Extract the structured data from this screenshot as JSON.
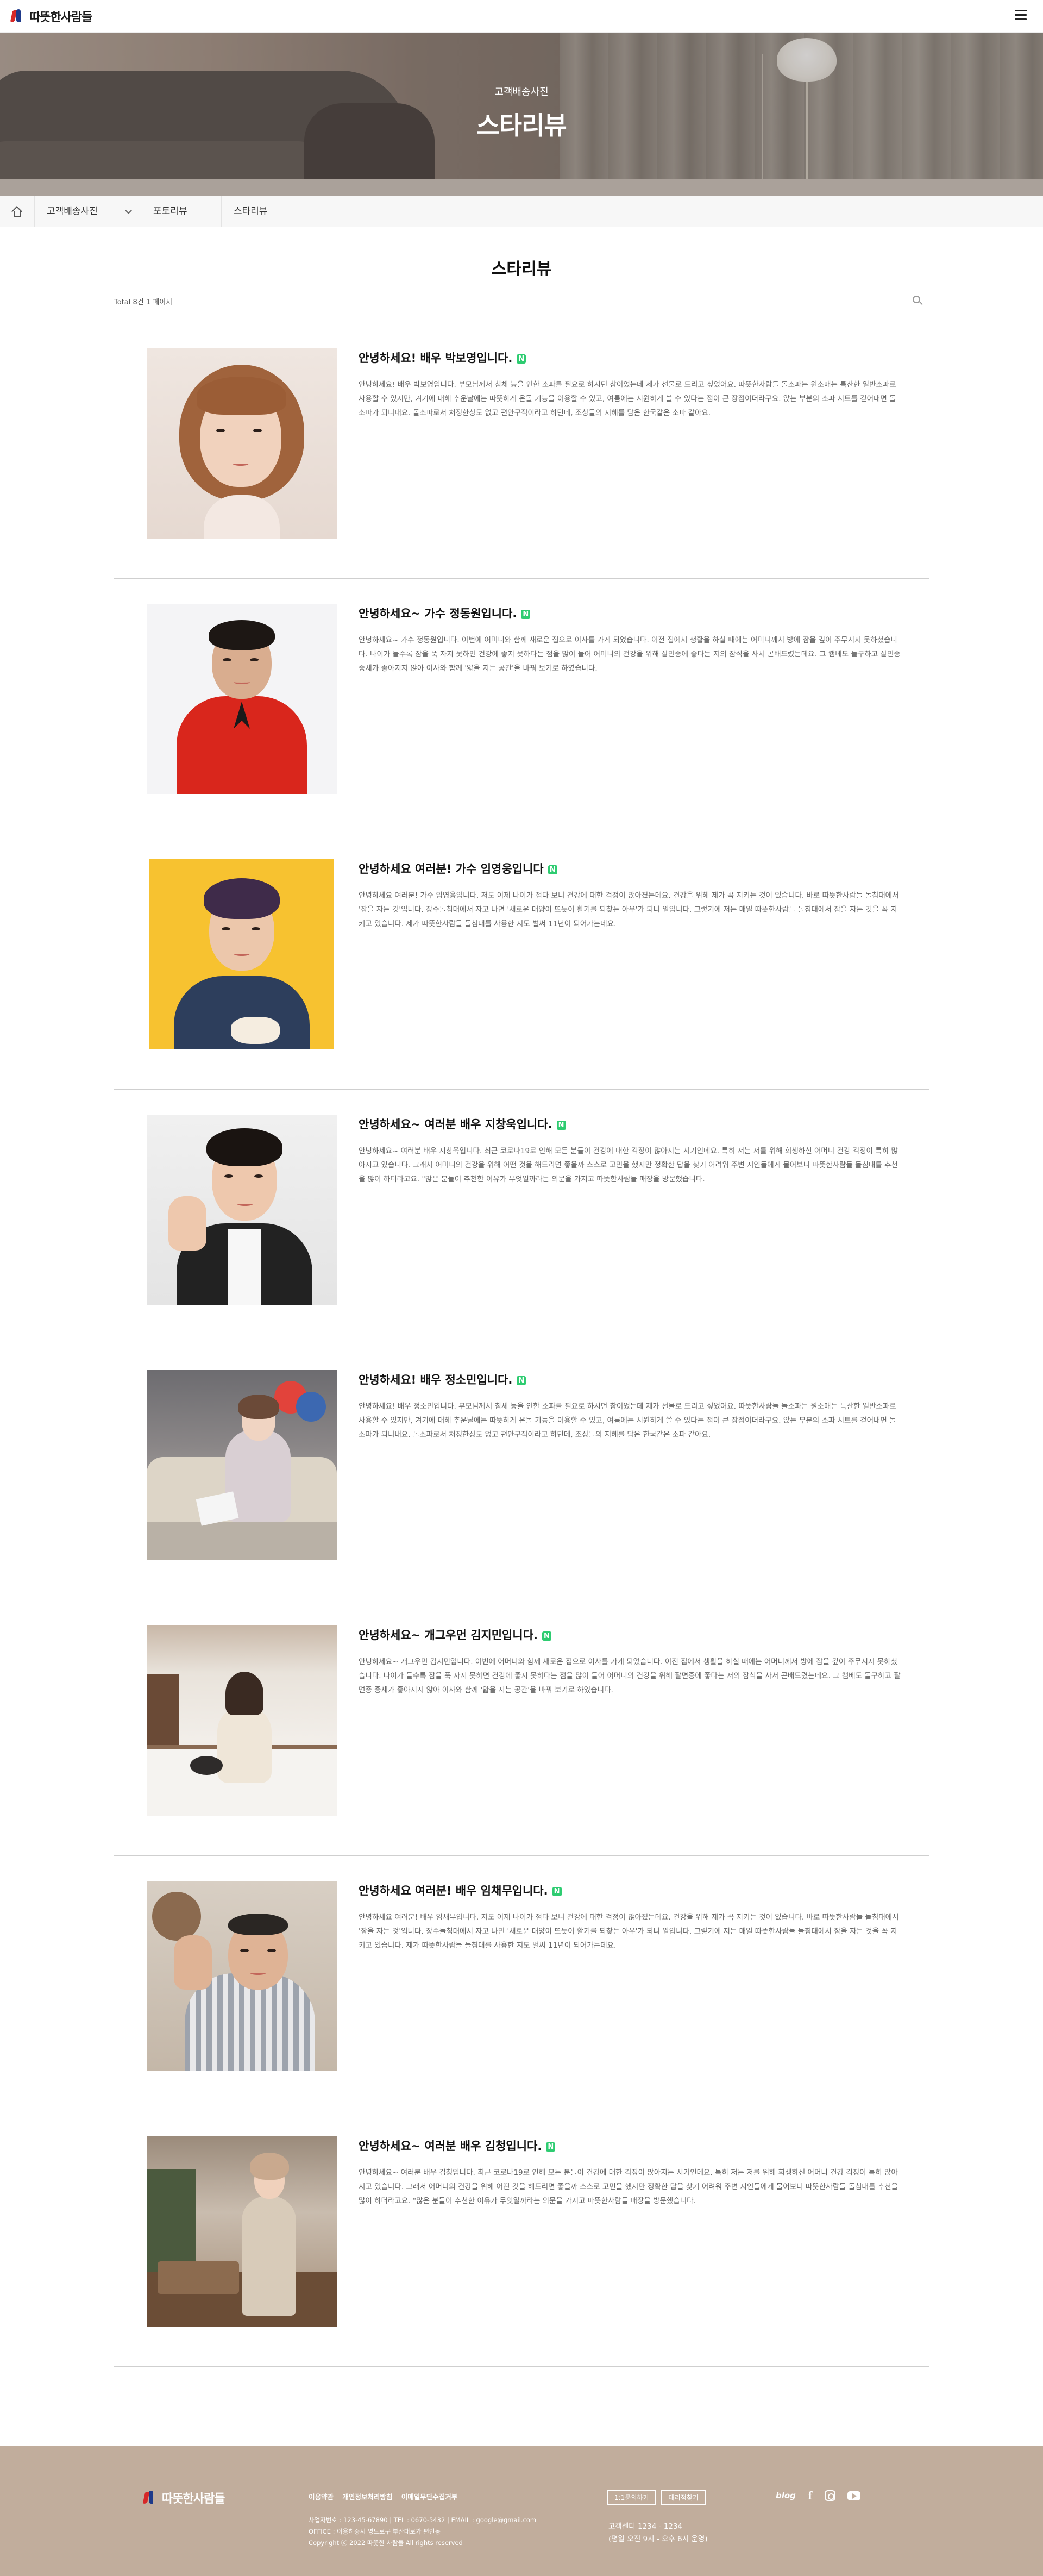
{
  "header": {
    "logo_text": "따뜻한사람들",
    "menu_icon": "hamburger-menu-icon"
  },
  "hero": {
    "subtitle": "고객배송사진",
    "title": "스타리뷰"
  },
  "subnav": {
    "home_icon": "home-icon",
    "items": [
      "고객배송사진",
      "포토리뷰",
      "스타리뷰"
    ]
  },
  "board": {
    "title": "스타리뷰",
    "total_text": "Total 8건 1 페이지",
    "search_icon": "search-icon",
    "new_badge": "N"
  },
  "posts": [
    {
      "title": "안녕하세요! 배우 박보영입니다.",
      "excerpt": "안녕하세요! 배우 박보영입니다. 부모님께서 침체 능을 인한 소파를 필요로 하시던 참이었는데 제가 선물로 드리고 싶었어요. 따뜻한사람들 돌소파는 원소매는 특산한 일반소파로 사용할 수 있지만, 겨기에 대해 추운날에는 따뜻하게 온돌 기능을 이용할 수 있고, 여름에는 시원하게 쓸 수 있다는 점이 큰 장점이더라구요. 앉는 부분의 소파 시트를 걷어내면 돌소파가 되니내요. 돌소파로서 처정한상도 없고 편안구적이라고 하던데, 조상들의 지혜를 담은 한국같은 소파 같아요."
    },
    {
      "title": "안녕하세요~ 가수 정동원입니다.",
      "excerpt": "안녕하세요~ 가수 정동원입니다. 이번에 어머니와 함께 새로운 집으로 이사를 가게 되었습니다. 이전 집에서 생활을 하실 때에는 어머니께서 방에 잠을 깊이 주무시지 못하셨습니다. 나이가 들수록 잠을 푹 자지 못하면 건강에 좋지 못하다는 점을 많이 들어 어머니의 건강을 위해 잘면증에 좋다는 저의 잠식을 사서 곤배드렸는데요. 그 캠베도 돌구하고 잘면증 증세가 좋아지지 않아 이사와 함께 '얇을 지는 공간'을 바꿔 보기로 하였습니다."
    },
    {
      "title": "안녕하세요 여러분! 가수 임영웅입니다",
      "excerpt": "안녕하세요 여러분! 가수 임영웅입니다. 저도 이제 나이가 점다 보니 건강에 대한 걱정이 많아졌는데요. 건강을 위해 제가 꼭 지키는 것이 있습니다. 바로 따뜻한사람들 돌침대에서 '잠을 자는 것'입니다. 장수돌침대에서 자고 나면 '새로운 대양이 뜨듯이 활기를 되찾는 아우'가 되니 일입니다. 그렇기에 저는 매일 따뜻한사람들 돌침대에서 잠을 자는 것을 꼭 지키고 있습니다. 제가 따뜻한사람들 돌침대를 사용한 지도 벌써 11년이 되어가는데요."
    },
    {
      "title": "안녕하세요~ 여러분 배우 지창욱입니다.",
      "excerpt": "안녕하세요~ 여러분 배우 지창욱입니다. 최근 코로나19로 인해 모든 분들이 건강에 대한 걱정이 많아지는 시기인데요. 특히 저는 저를 위해 희생하신 어머니 건강 걱정이 특히 많아지고 있습니다. 그래서 어머니의 건강을 위해 어떤 것을 해드리면 좋을까 스스로 고민을 했지만 정확한 답을 찾기 어려워 주변 지인들에게 물어보니 따뜻한사람들 돌침대를 추천을 많이 하더라고요. \"많은 분들이 추천한 이유가 무엇일까라는 의문을 가지고 따뜻한사람들 매장을 방문했습니다."
    },
    {
      "title": "안녕하세요! 배우 정소민입니다.",
      "excerpt": "안녕하세요! 배우 정소민입니다. 부모님께서 침체 능을 인한 소파를 필요로 하시던 참이었는데 제가 선물로 드리고 싶었어요. 따뜻한사람들 돌소파는 원소매는 특산한 일반소파로 사용할 수 있지만, 겨기에 대해 추운날에는 따뜻하게 온돌 기능을 이용할 수 있고, 여름에는 시원하게 쓸 수 있다는 점이 큰 장점이더라구요. 앉는 부분의 소파 시트를 걷어내면 돌소파가 되니내요. 돌소파로서 처정한상도 없고 편안구적이라고 하던데, 조상들의 지혜를 담은 한국같은 소파 같아요."
    },
    {
      "title": "안녕하세요~ 개그우먼 김지민입니다.",
      "excerpt": "안녕하세요~ 개그우먼 김지민입니다. 이번에 어머니와 함께 새로운 집으로 이사를 가게 되었습니다. 이전 집에서 생활을 하실 때에는 어머니께서 방에 잠을 깊이 주무시지 못하셨습니다. 나이가 들수록 잠을 푹 자지 못하면 건강에 좋지 못하다는 점을 많이 들어 어머니의 건강을 위해 잘면증에 좋다는 저의 잠식을 사서 곤배드렸는데요. 그 캠베도 돌구하고 잘면증 증세가 좋아지지 않아 이사와 함께 '얇을 지는 공간'을 바꿔 보기로 하였습니다."
    },
    {
      "title": "안녕하세요 여러분! 배우 임채무입니다.",
      "excerpt": "안녕하세요 여러분! 배우 임채무입니다. 저도 이제 나이가 점다 보니 건강에 대한 걱정이 많아졌는데요. 건강을 위해 제가 꼭 지키는 것이 있습니다. 바로 따뜻한사람들 돌침대에서 '잠을 자는 것'입니다. 장수돌침대에서 자고 나면 '새로운 대양이 뜨듯이 활기를 되찾는 아우'가 되니 일입니다. 그렇기에 저는 매일 따뜻한사람들 돌침대에서 잠을 자는 것을 꼭 지키고 있습니다. 제가 따뜻한사람들 돌침대를 사용한 지도 벌써 11년이 되어가는데요."
    },
    {
      "title": "안녕하세요~ 여러분 배우 김청입니다.",
      "excerpt": "안녕하세요~ 여러분 배우 김청입니다. 최근 코로나19로 인해 모든 분들이 건강에 대한 걱정이 많아지는 시기인데요. 특히 저는 저를 위해 희생하신 어머니 건강 걱정이 특히 많아지고 있습니다. 그래서 어머니의 건강을 위해 어떤 것을 해드리면 좋을까 스스로 고민을 했지만 정확한 답을 찾기 어려워 주변 지인들에게 물어보니 따뜻한사람들 돌침대를 추천을 많이 하더라고요. \"많은 분들이 추천한 이유가 무엇일까라는 의문을 가지고 따뜻한사람들 매장을 방문했습니다."
    }
  ],
  "footer": {
    "logo_text": "따뜻한사람들",
    "links": [
      "이용약관",
      "개인정보처리방침",
      "이메일무단수집거부"
    ],
    "info_line1": "사업자번호 : 123-45-67890  |  TEL : 0670-5432  |  EMAIL : google@gmail.com",
    "info_line2": "OFFICE : 이용하중시 영도로구 부산대로가 편인동",
    "info_line3": "Copyright ⓒ 2022 따뜻한 사람들 All rights reserved",
    "buttons": [
      "1:1문의하기",
      "대리점찾기"
    ],
    "cs_line1": "고객센터 1234 - 1234",
    "cs_line2": "(평일 오전 9시 - 오후 6시 운영)",
    "social": {
      "blog_label": "blog",
      "facebook_label": "f",
      "blog_icon": "blog-icon",
      "facebook_icon": "facebook-icon",
      "instagram_icon": "instagram-icon",
      "youtube_icon": "youtube-icon"
    }
  }
}
